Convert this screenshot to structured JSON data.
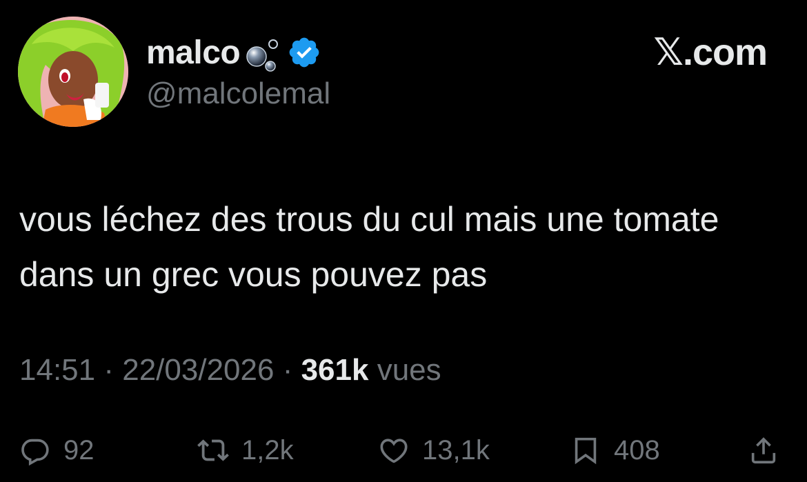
{
  "user": {
    "display_name": "malco",
    "handle": "@malcolemal",
    "verified": true,
    "avatar": "anime-character-avatar"
  },
  "brand": {
    "label": "𝕏.com"
  },
  "tweet": {
    "text": "vous léchez des trous du cul mais une tomate dans un grec vous pouvez pas"
  },
  "meta": {
    "time": "14:51",
    "separator": "·",
    "date": "22/03/2026",
    "views_count": "361k",
    "views_label": "vues"
  },
  "actions": {
    "replies": "92",
    "reposts": "1,2k",
    "likes": "13,1k",
    "bookmarks": "408"
  },
  "colors": {
    "background": "#000000",
    "primary_text": "#e7e9ea",
    "secondary_text": "#71767b",
    "verified_badge": "#1d9bf0"
  }
}
